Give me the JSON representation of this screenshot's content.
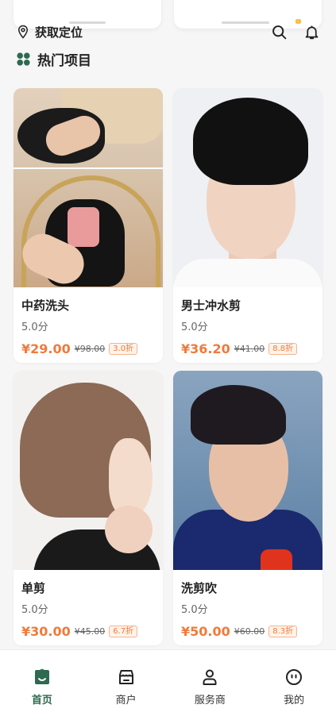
{
  "location": {
    "label": "获取定位"
  },
  "section": {
    "title": "热门项目"
  },
  "colors": {
    "accent_green": "#2e6a50",
    "price_orange": "#f07a3a"
  },
  "products": [
    {
      "name": "中药洗头",
      "score": "5.0分",
      "price": "¥29.00",
      "original_price": "¥98.00",
      "discount": "3.0折",
      "image": "hair-wash-photo"
    },
    {
      "name": "男士冲水剪",
      "score": "5.0分",
      "price": "¥36.20",
      "original_price": "¥41.00",
      "discount": "8.8折",
      "image": "men-haircut-photo"
    },
    {
      "name": "单剪",
      "score": "5.0分",
      "price": "¥30.00",
      "original_price": "¥45.00",
      "discount": "6.7折",
      "image": "bob-haircut-photo"
    },
    {
      "name": "洗剪吹",
      "score": "5.0分",
      "price": "¥50.00",
      "original_price": "¥60.00",
      "discount": "8.3折",
      "image": "short-haircut-photo"
    }
  ],
  "nav": {
    "items": [
      {
        "label": "首页",
        "icon": "home-icon",
        "active": true
      },
      {
        "label": "商户",
        "icon": "shop-icon",
        "active": false
      },
      {
        "label": "服务商",
        "icon": "user-icon",
        "active": false
      },
      {
        "label": "我的",
        "icon": "profile-face-icon",
        "active": false
      }
    ]
  }
}
